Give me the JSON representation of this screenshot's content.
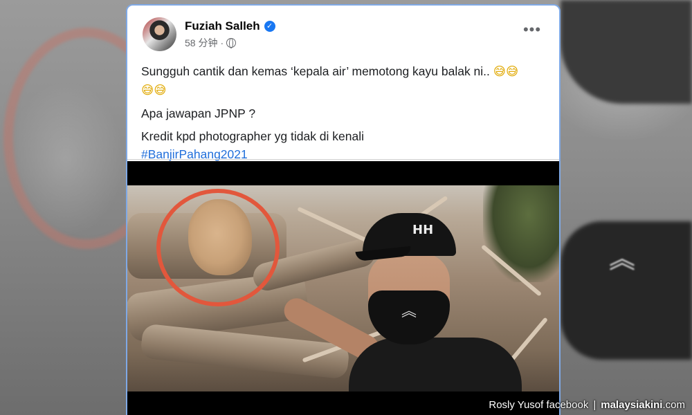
{
  "post": {
    "author": "Fuziah Salleh",
    "timestamp": "58 分钟",
    "meta_separator": "·",
    "verified_icon": "verified-badge-icon",
    "privacy_icon": "globe-icon",
    "more_label": "•••",
    "text_line_1": "Sungguh cantik dan kemas ‘kepala air’ memotong kayu balak ni..",
    "emoji_1": "😅😅",
    "emoji_2": "😅😅",
    "text_line_2": "Apa jawapan JPNP ?",
    "text_line_3": "Kredit kpd photographer yg tidak di kenali",
    "hashtag": "#BanjirPahang2021"
  },
  "media": {
    "annotation_color": "#e2573c",
    "cap_logo": "HH",
    "mask_chevron": "︽"
  },
  "caption": {
    "credit": "Rosly Yusof facebook",
    "separator": "|",
    "brand": "malaysiakini",
    "brand_tld": ".com"
  },
  "colors": {
    "link_blue": "#216fdb",
    "card_border": "#7fa9e6",
    "verified_blue": "#1877f2"
  }
}
